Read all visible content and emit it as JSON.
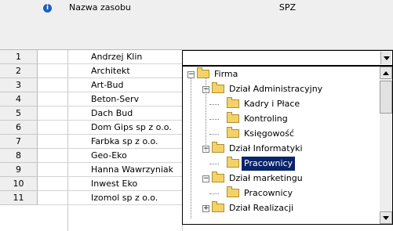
{
  "columns": {
    "info_icon": "info-icon",
    "info_glyph": "i",
    "name_header": "Nazwa zasobu",
    "spz_header": "SPZ"
  },
  "rows": [
    {
      "num": "1",
      "name": "Andrzej Klin"
    },
    {
      "num": "2",
      "name": "Architekt"
    },
    {
      "num": "3",
      "name": "Art-Bud"
    },
    {
      "num": "4",
      "name": "Beton-Serv"
    },
    {
      "num": "5",
      "name": "Dach Bud"
    },
    {
      "num": "6",
      "name": "Dom Gips sp z o.o."
    },
    {
      "num": "7",
      "name": "Farbka sp z o.o."
    },
    {
      "num": "8",
      "name": "Geo-Eko"
    },
    {
      "num": "9",
      "name": "Hanna Wawrzyniak"
    },
    {
      "num": "10",
      "name": "Inwest Eko"
    },
    {
      "num": "11",
      "name": "Izomol sp z o.o."
    }
  ],
  "combo": {
    "value": ""
  },
  "tree": [
    {
      "label": "Firma",
      "expander": "⊟",
      "selected": false
    },
    {
      "label": "Dział Administracyjny",
      "expander": "⊟",
      "selected": false
    },
    {
      "label": "Kadry i Płace",
      "expander": "",
      "selected": false
    },
    {
      "label": "Kontroling",
      "expander": "",
      "selected": false
    },
    {
      "label": "Księgowość",
      "expander": "",
      "selected": false
    },
    {
      "label": "Dział Informatyki",
      "expander": "⊟",
      "selected": false
    },
    {
      "label": "Pracownicy",
      "expander": "",
      "selected": true
    },
    {
      "label": "Dział marketingu",
      "expander": "⊟",
      "selected": false
    },
    {
      "label": "Pracownicy",
      "expander": "",
      "selected": false
    },
    {
      "label": "Dział Realizacji",
      "expander": "⊞",
      "selected": false
    }
  ],
  "colors": {
    "selection": "#0a246a",
    "folder": "#f3d26a",
    "header_bg": "#efefef"
  }
}
